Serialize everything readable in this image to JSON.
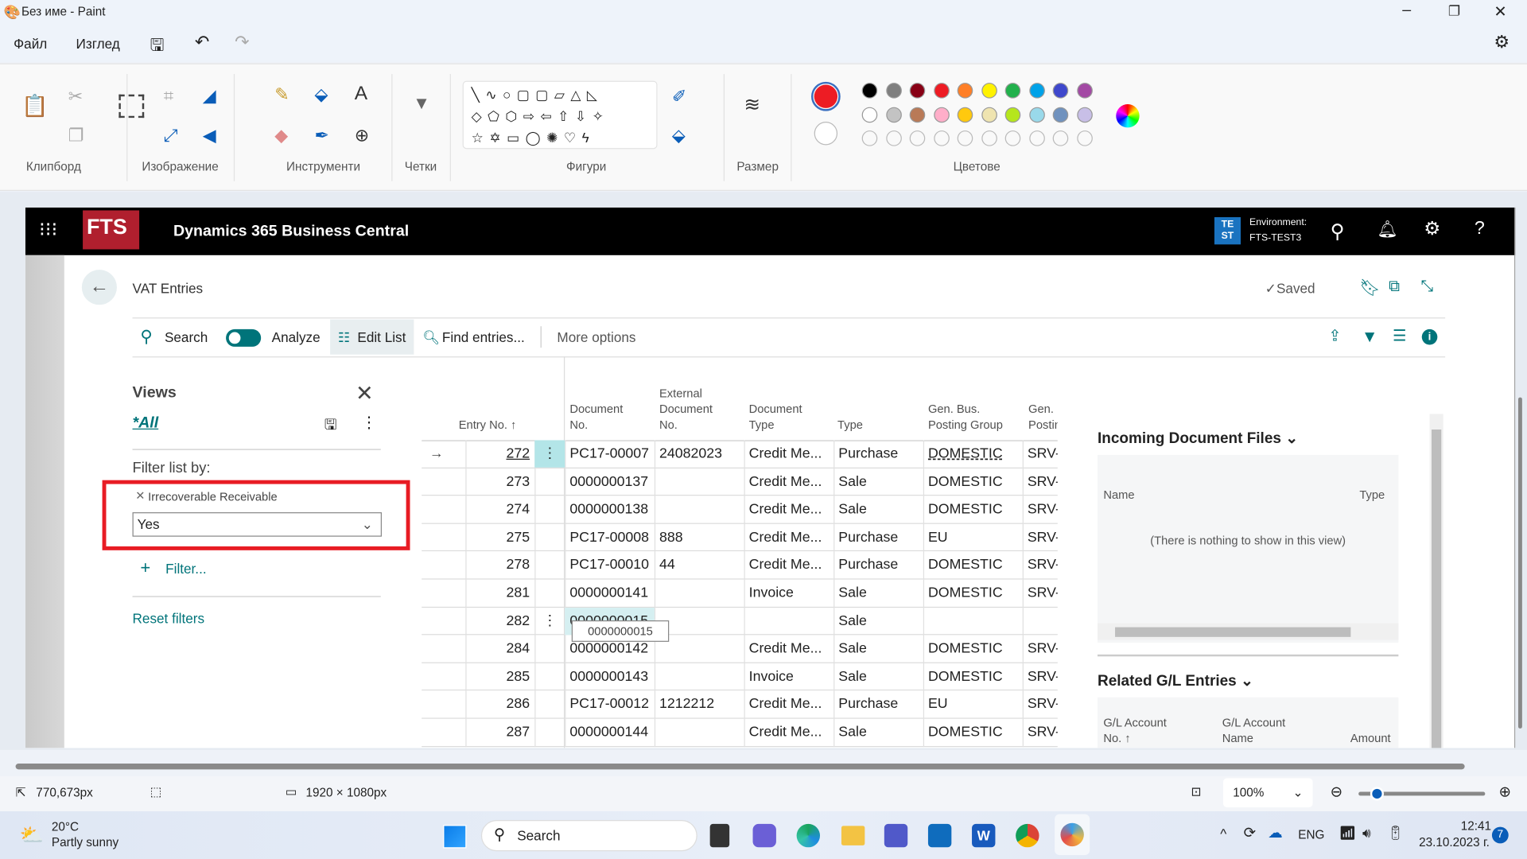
{
  "window": {
    "title": "Без име - Paint"
  },
  "menu": {
    "file": "Файл",
    "view": "Изглед"
  },
  "ribbon": {
    "groups": [
      "Клипборд",
      "Изображение",
      "Инструменти",
      "Четки",
      "Фигури",
      "Размер",
      "Цветове"
    ],
    "primary_color": "#ed1c24",
    "secondary_color": "#ffffff",
    "palette_row1": [
      "#000000",
      "#7f7f7f",
      "#880015",
      "#ed1c24",
      "#ff7f27",
      "#fff200",
      "#22b14c",
      "#00a2e8",
      "#3f48cc",
      "#a349a4"
    ],
    "palette_row2": [
      "#ffffff",
      "#c3c3c3",
      "#b97a57",
      "#ffaec9",
      "#ffc90e",
      "#efe4b0",
      "#b5e61d",
      "#99d9ea",
      "#7092be",
      "#c8bfe7"
    ]
  },
  "bc": {
    "logo": "FTS",
    "app_title": "Dynamics 365 Business Central",
    "env_badge": "TE ST",
    "env_label": "Environment:",
    "env_name": "FTS-TEST3",
    "page_title": "VAT Entries",
    "saved": "Saved",
    "actions": {
      "search": "Search",
      "analyze": "Analyze",
      "edit_list": "Edit List",
      "find_entries": "Find entries...",
      "more_options": "More options"
    },
    "views": {
      "title": "Views",
      "current": "*All",
      "filter_by": "Filter list by:",
      "filter_field": "Irrecoverable Receivable",
      "filter_value": "Yes",
      "add_filter": "Filter...",
      "reset": "Reset filters"
    },
    "table": {
      "headers": {
        "entry_no": "Entry No. ↑",
        "doc_no": [
          "Document",
          "No."
        ],
        "ext_doc_no": [
          "External",
          "Document",
          "No."
        ],
        "doc_type": [
          "Document",
          "Type"
        ],
        "type": "Type",
        "gen_bus": [
          "Gen. Bus.",
          "Posting Group"
        ],
        "gen_prod": [
          "Gen.",
          "Postin"
        ]
      },
      "rows": [
        {
          "entry": "272",
          "doc": "PC17-00007",
          "ext": "24082023",
          "doctype": "Credit Me...",
          "type": "Purchase",
          "bus": "DOMESTIC",
          "prod": "SRV-"
        },
        {
          "entry": "273",
          "doc": "0000000137",
          "ext": "",
          "doctype": "Credit Me...",
          "type": "Sale",
          "bus": "DOMESTIC",
          "prod": "SRV-"
        },
        {
          "entry": "274",
          "doc": "0000000138",
          "ext": "",
          "doctype": "Credit Me...",
          "type": "Sale",
          "bus": "DOMESTIC",
          "prod": "SRV-"
        },
        {
          "entry": "275",
          "doc": "PC17-00008",
          "ext": "888",
          "doctype": "Credit Me...",
          "type": "Purchase",
          "bus": "EU",
          "prod": "SRV-"
        },
        {
          "entry": "278",
          "doc": "PC17-00010",
          "ext": "44",
          "doctype": "Credit Me...",
          "type": "Purchase",
          "bus": "DOMESTIC",
          "prod": "SRV-"
        },
        {
          "entry": "281",
          "doc": "0000000141",
          "ext": "",
          "doctype": "Invoice",
          "type": "Sale",
          "bus": "DOMESTIC",
          "prod": "SRV-"
        },
        {
          "entry": "282",
          "doc": "0000000015",
          "ext": "",
          "doctype": "",
          "type": "Sale",
          "bus": "",
          "prod": ""
        },
        {
          "entry": "284",
          "doc": "0000000142",
          "ext": "",
          "doctype": "Credit Me...",
          "type": "Sale",
          "bus": "DOMESTIC",
          "prod": "SRV-"
        },
        {
          "entry": "285",
          "doc": "0000000143",
          "ext": "",
          "doctype": "Invoice",
          "type": "Sale",
          "bus": "DOMESTIC",
          "prod": "SRV-"
        },
        {
          "entry": "286",
          "doc": "PC17-00012",
          "ext": "1212212",
          "doctype": "Credit Me...",
          "type": "Purchase",
          "bus": "EU",
          "prod": "SRV-"
        },
        {
          "entry": "287",
          "doc": "0000000144",
          "ext": "",
          "doctype": "Credit Me...",
          "type": "Sale",
          "bus": "DOMESTIC",
          "prod": "SRV-"
        }
      ],
      "tooltip": "0000000015"
    },
    "factbox": {
      "incoming_title": "Incoming Document Files",
      "incoming_cols": [
        "Name",
        "Type"
      ],
      "incoming_empty": "(There is nothing to show in this view)",
      "gl_title": "Related G/L Entries",
      "gl_cols": [
        [
          "G/L Account",
          "No. ↑"
        ],
        [
          "G/L Account",
          "Name"
        ],
        "Amount"
      ]
    }
  },
  "status": {
    "cursor": "770,673px",
    "size": "1920 × 1080px",
    "zoom": "100%"
  },
  "taskbar": {
    "weather_temp": "20°C",
    "weather_desc": "Partly sunny",
    "search": "Search",
    "lang": "ENG",
    "time": "12:41",
    "date": "23.10.2023 г.",
    "notifications": "7"
  }
}
